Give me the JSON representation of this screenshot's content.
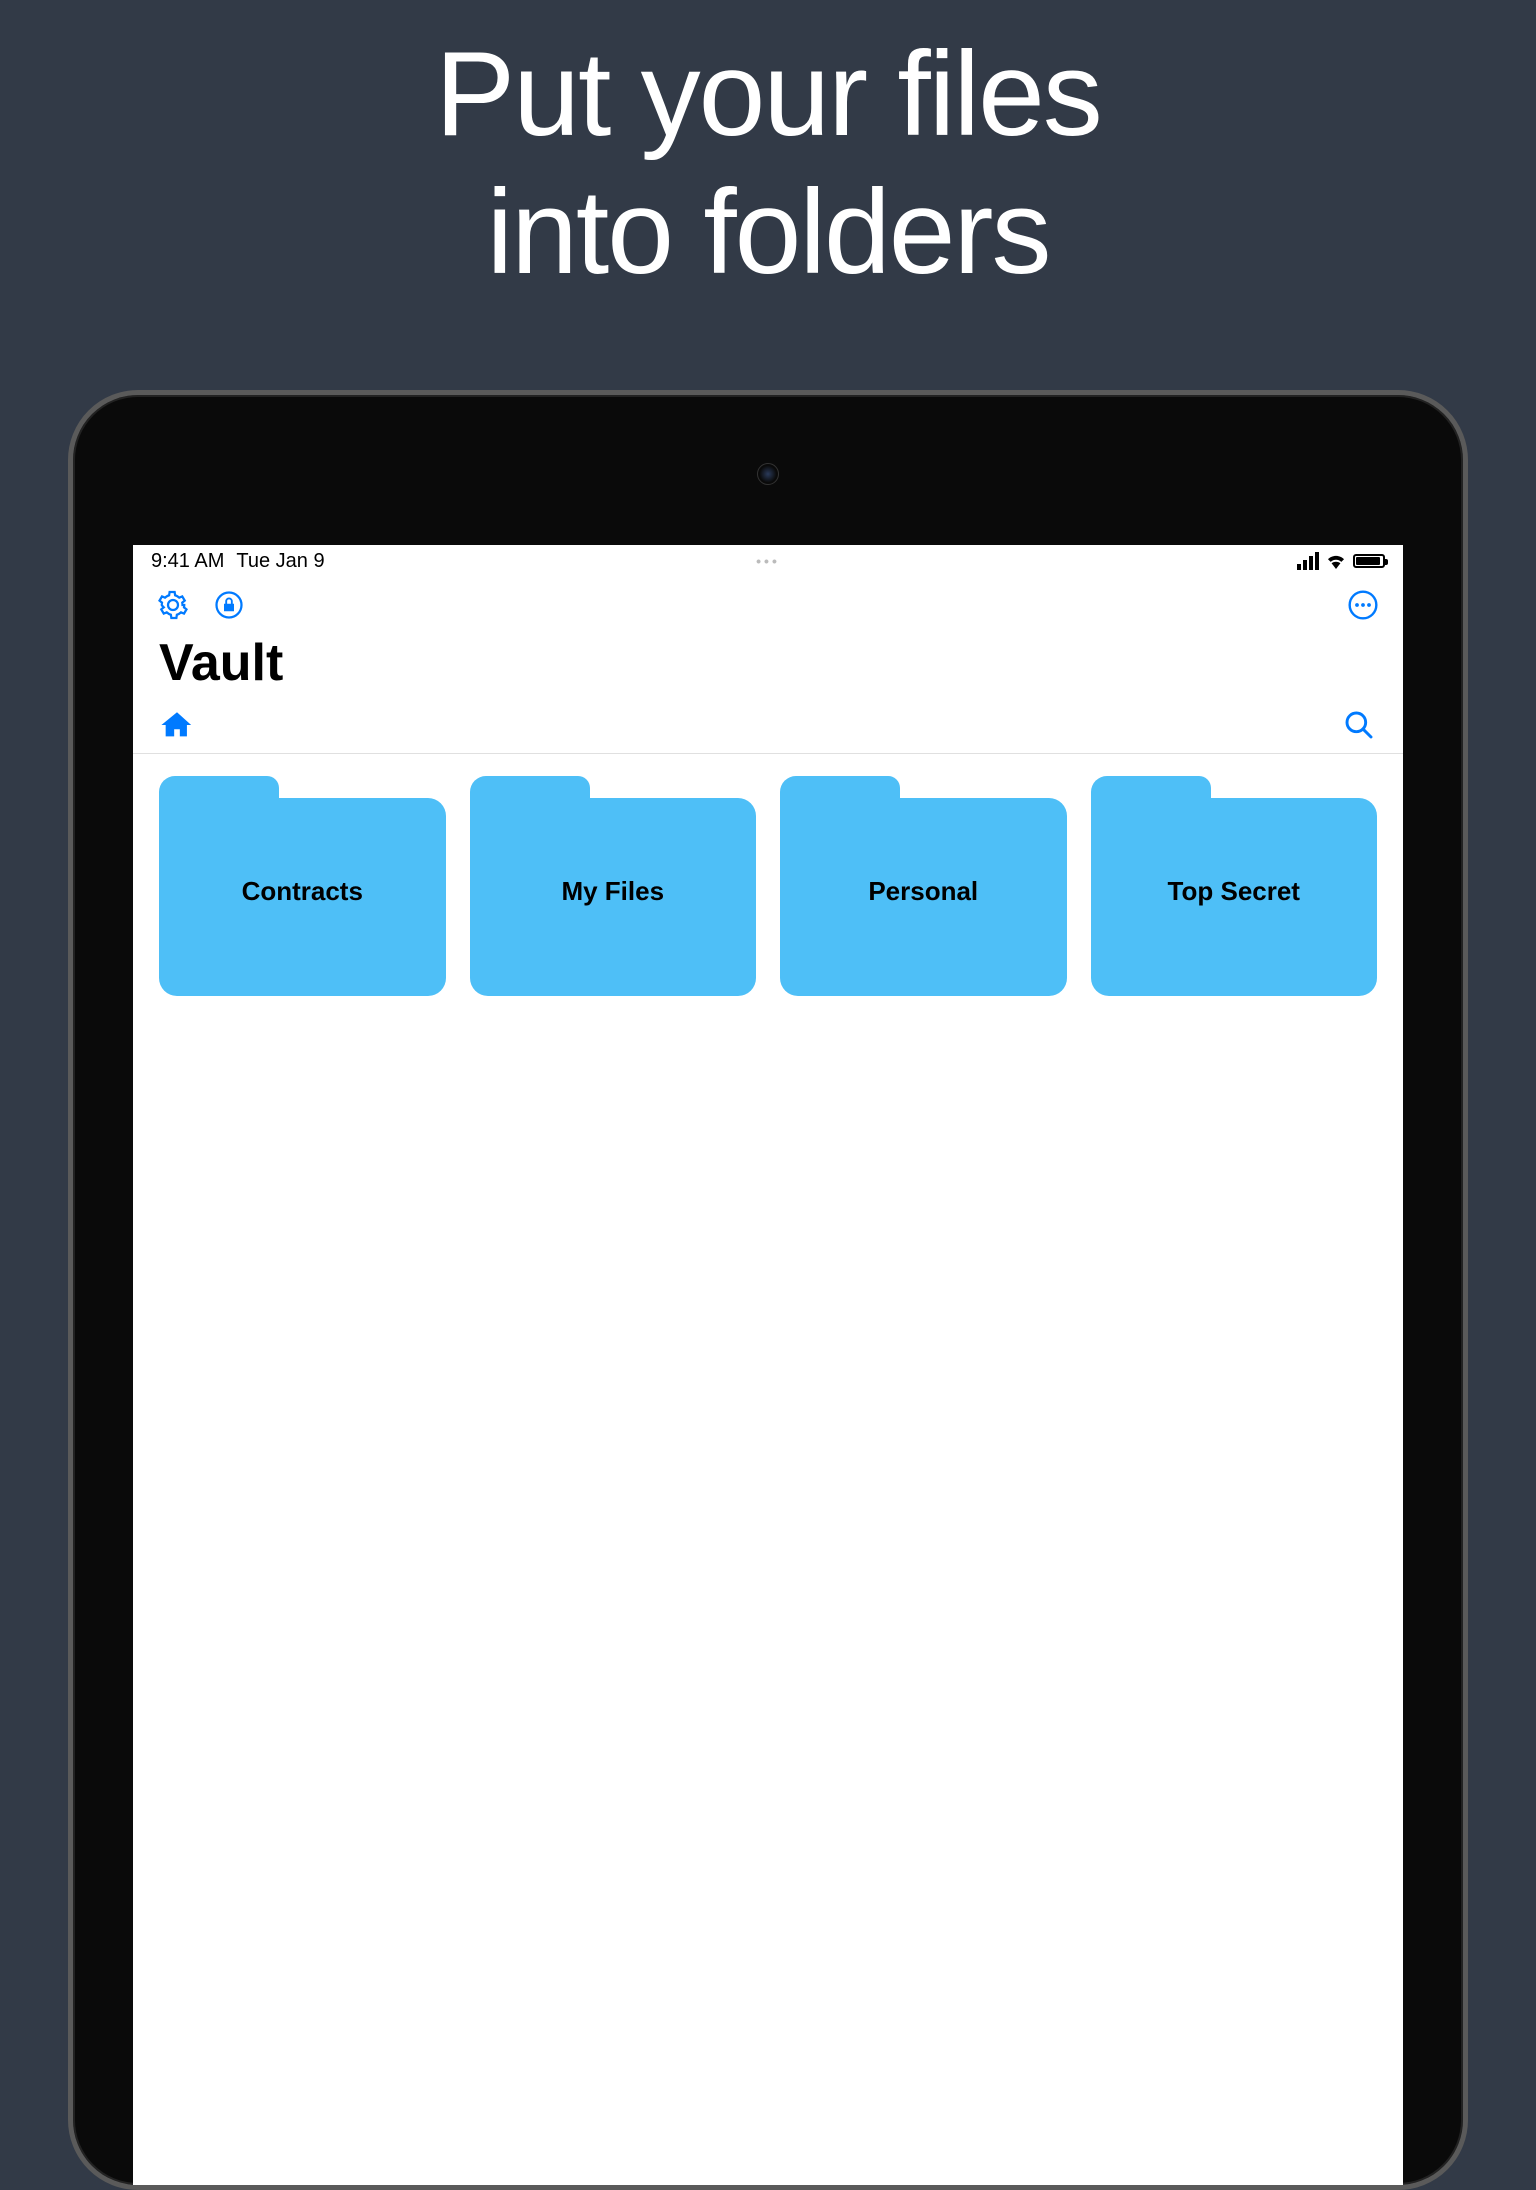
{
  "hero": {
    "line1": "Put your files",
    "line2": "into folders"
  },
  "statusBar": {
    "time": "9:41 AM",
    "date": "Tue Jan 9"
  },
  "toolbar": {
    "settings_icon": "gear-icon",
    "lock_icon": "lock-icon",
    "more_icon": "more-icon"
  },
  "page": {
    "title": "Vault"
  },
  "subbar": {
    "home_icon": "home-icon",
    "search_icon": "search-icon"
  },
  "folders": [
    {
      "label": "Contracts"
    },
    {
      "label": "My Files"
    },
    {
      "label": "Personal"
    },
    {
      "label": "Top Secret"
    }
  ],
  "colors": {
    "accent": "#007AFF",
    "folder": "#4EBFF7",
    "background": "#323A47"
  }
}
